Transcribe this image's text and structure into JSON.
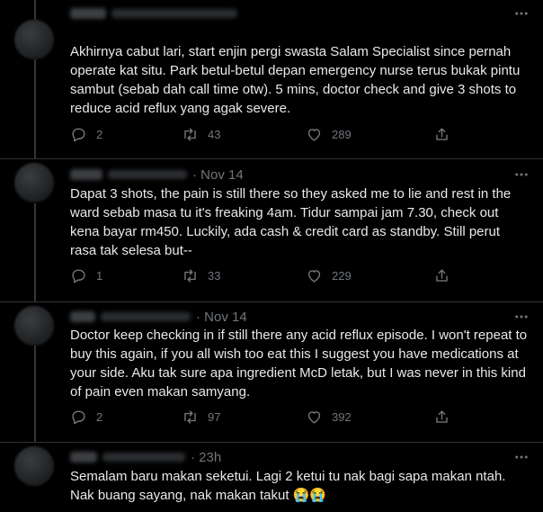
{
  "tweets": [
    {
      "time": "",
      "text": "Akhirnya cabut lari, start enjin pergi swasta Salam Specialist since pernah operate kat situ. Park betul-betul depan emergency nurse terus bukak pintu sambut (sebab dah call time otw). 5 mins, doctor check and give 3 shots to reduce acid reflux yang agak severe.",
      "replies": "2",
      "retweets": "43",
      "likes": "289"
    },
    {
      "time": "· Nov 14",
      "text": "Dapat 3 shots, the pain is still there so they asked me to lie and rest in the ward sebab masa tu it's freaking 4am. Tidur sampai jam 7.30, check out kena bayar rm450. Luckily, ada cash & credit card as standby. Still perut rasa tak selesa but--",
      "replies": "1",
      "retweets": "33",
      "likes": "229"
    },
    {
      "time": "· Nov 14",
      "text": "Doctor keep checking in if still there any acid reflux episode. I won't repeat to buy this again, if you all wish too eat this I suggest you have medications at your side. Aku tak sure apa ingredient McD letak, but I was never in this kind of pain even makan samyang.",
      "replies": "2",
      "retweets": "97",
      "likes": "392"
    },
    {
      "time": "· 23h",
      "text": "Semalam baru makan seketui. Lagi 2 ketui tu nak bagi sapa makan ntah. Nak buang sayang, nak makan takut 😭😭",
      "replies": "",
      "retweets": "",
      "likes": ""
    }
  ],
  "icons": {
    "reply": "reply-icon",
    "retweet": "retweet-icon",
    "like": "heart-icon",
    "share": "share-icon",
    "more": "more-icon"
  },
  "colors": {
    "background": "#000000",
    "text": "#e7e9ea",
    "muted": "#71767b",
    "divider": "#2f3336"
  }
}
